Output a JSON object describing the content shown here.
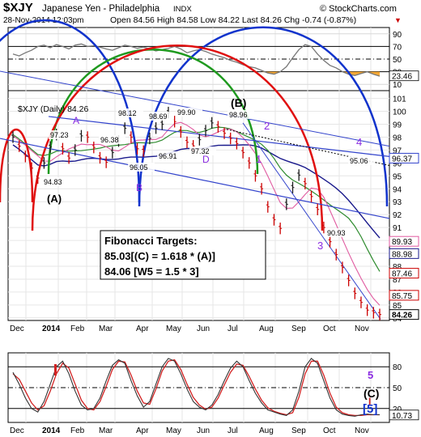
{
  "header": {
    "symbol": "$XJY",
    "name": "Japanese Yen - Philadelphia",
    "exchange": "INDX",
    "source": "© StockCharts.com",
    "datetime": "28-Nov-2014 12:03pm",
    "quote": "Open 84.56  High 84.58  Low 84.22  Last 84.26  Chg -0.74 (-0.87%)",
    "down_marker": "▼"
  },
  "colors": {
    "price": "#1a1a1a",
    "ma50": "#2e8b2e",
    "ma200": "#1a1a8c",
    "ma_pink": "#e05aa0",
    "arc_blue": "#1133cc",
    "arc_green": "#1f9a1f",
    "arc_red": "#e01010",
    "trend": "#3344cc",
    "rsi": "#777777",
    "rsi_fill": "#f5a020",
    "label_purple": "#8a2be2",
    "stoch_red": "#d22222",
    "stoch_line": "#333333"
  },
  "chart_data": [
    {
      "type": "line",
      "panel": "RSI",
      "ylim": [
        0,
        100
      ],
      "ticks": [
        10,
        30,
        50,
        70,
        90
      ],
      "last_label": "23.46",
      "values": [
        58,
        55,
        60,
        64,
        70,
        72,
        68,
        73,
        70,
        66,
        72,
        74,
        70,
        71,
        69,
        66,
        64,
        68,
        72,
        70,
        67,
        69,
        66,
        63,
        65,
        67,
        70,
        66,
        60,
        63,
        65,
        62,
        58,
        55,
        52,
        48,
        45,
        41,
        38,
        36,
        32,
        28,
        26,
        30,
        38,
        52,
        65,
        73,
        70,
        58,
        48,
        40,
        36,
        30,
        26,
        24,
        27,
        30,
        26,
        23
      ]
    },
    {
      "type": "line",
      "panel": "Price",
      "title": "$XJY (Daily) 84.26",
      "ylim": [
        83.8,
        101.6
      ],
      "ticks": [
        84,
        85,
        86,
        87,
        88,
        89,
        90,
        91,
        92,
        93,
        94,
        95,
        96,
        97,
        98,
        99,
        100,
        101
      ],
      "series": [
        {
          "name": "$XJY (Daily)",
          "values": [
            98.0,
            97.3,
            96.5,
            95.6,
            94.83,
            96.0,
            97.23,
            98.2,
            97.1,
            96.38,
            97.0,
            98.1,
            98.0,
            97.2,
            96.4,
            96.05,
            96.8,
            97.7,
            98.69,
            98.0,
            97.1,
            96.91,
            97.9,
            98.7,
            99.0,
            99.9,
            99.2,
            98.4,
            97.6,
            97.32,
            97.8,
            98.5,
            99.1,
            98.8,
            98.3,
            97.9,
            97.5,
            96.8,
            96.0,
            95.0,
            94.0,
            92.6,
            91.6,
            90.93,
            92.8,
            94.1,
            95.06,
            94.4,
            93.4,
            92.4,
            91.0,
            89.9,
            88.9,
            87.9,
            86.9,
            85.9,
            85.2,
            84.6,
            84.4,
            84.26
          ]
        }
      ],
      "last_label": "84.26",
      "level_labels": [
        "96.37",
        "89.93",
        "88.98",
        "87.46",
        "85.75"
      ],
      "pivot_labels": [
        "97.23",
        "94.83",
        "96.38",
        "98.12",
        "96.05",
        "98.69",
        "96.91",
        "99.90",
        "97.32",
        "98.96",
        "95.06",
        "90.93"
      ],
      "wave_labels": [
        "(A)",
        "A",
        "B",
        "D",
        "(B)",
        "1",
        "2",
        "3",
        "4"
      ],
      "fibonacci": {
        "heading": "Fibonacci Targets:",
        "line1": "85.03[(C) = 1.618 * (A)]",
        "line2": "84.06 [W5 = 1.5 * 3]"
      }
    },
    {
      "type": "line",
      "panel": "Stochastic",
      "ylim": [
        0,
        100
      ],
      "ticks": [
        20,
        50,
        80
      ],
      "last_label": "10.73",
      "values": [
        72,
        55,
        35,
        20,
        15,
        30,
        55,
        80,
        88,
        70,
        45,
        25,
        18,
        20,
        35,
        60,
        82,
        90,
        85,
        60,
        38,
        22,
        30,
        55,
        80,
        92,
        88,
        70,
        48,
        30,
        22,
        18,
        25,
        40,
        60,
        78,
        88,
        80,
        60,
        42,
        28,
        18,
        15,
        12,
        10,
        18,
        45,
        80,
        92,
        85,
        60,
        35,
        18,
        12,
        10,
        9,
        11,
        12,
        11,
        11
      ],
      "signal": [
        70,
        62,
        45,
        28,
        18,
        24,
        45,
        70,
        85,
        78,
        55,
        32,
        20,
        18,
        30,
        52,
        76,
        88,
        87,
        68,
        45,
        28,
        26,
        48,
        74,
        88,
        90,
        76,
        55,
        36,
        25,
        19,
        22,
        35,
        54,
        72,
        84,
        82,
        66,
        48,
        32,
        21,
        16,
        13,
        11,
        14,
        36,
        70,
        88,
        88,
        68,
        42,
        22,
        14,
        11,
        10,
        10,
        11,
        11,
        11
      ],
      "wave_labels": [
        "5",
        "(C)",
        "[5]",
        "I"
      ]
    }
  ],
  "x_axis": {
    "labels": [
      "Dec",
      "2014",
      "Feb",
      "Mar",
      "Apr",
      "May",
      "Jun",
      "Jul",
      "Aug",
      "Sep",
      "Oct",
      "Nov"
    ]
  }
}
